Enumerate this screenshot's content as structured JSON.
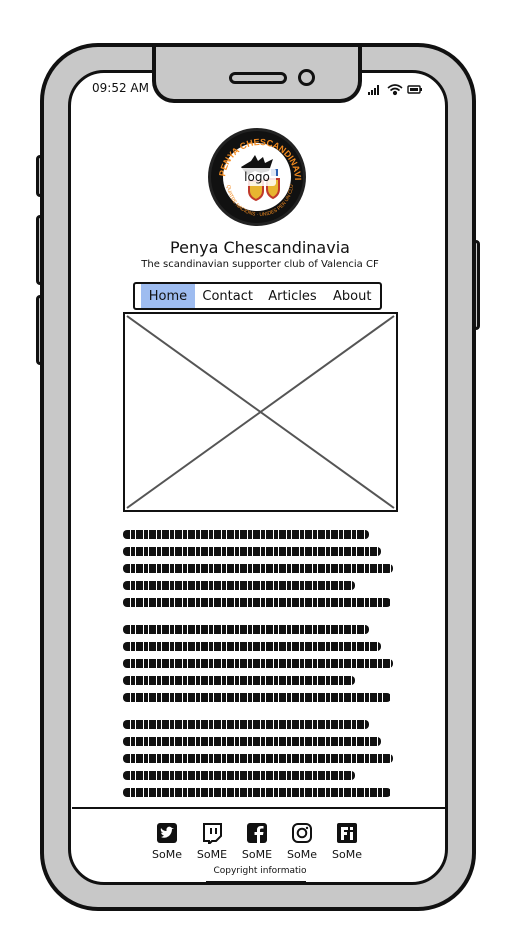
{
  "status_bar": {
    "time": "09:52 AM"
  },
  "logo": {
    "label": "logo",
    "ring_text_top": "PENYA CHESCANDINAVIA",
    "ring_text_bottom": "QUATRE NACIONS · UNIDES PER UN CLUB"
  },
  "header": {
    "title": "Penya Chescandinavia",
    "subtitle": "The scandinavian supporter club of Valencia CF"
  },
  "nav": {
    "items": [
      {
        "label": "Home"
      },
      {
        "label": "Contact"
      },
      {
        "label": "Articles"
      },
      {
        "label": "About"
      }
    ]
  },
  "footer": {
    "social": [
      {
        "label": "SoMe",
        "icon": "twitter-icon"
      },
      {
        "label": "SoME",
        "icon": "twitch-icon"
      },
      {
        "label": "SoME",
        "icon": "facebook-icon"
      },
      {
        "label": "SoMe",
        "icon": "instagram-icon"
      },
      {
        "label": "SoMe",
        "icon": "foursquare-icon"
      }
    ],
    "copyright": "Copyright informatio"
  },
  "colors": {
    "nav_active": "#9ebcf0",
    "logo_orange": "#f28a1f",
    "frame_gray": "#c8c8c8"
  }
}
